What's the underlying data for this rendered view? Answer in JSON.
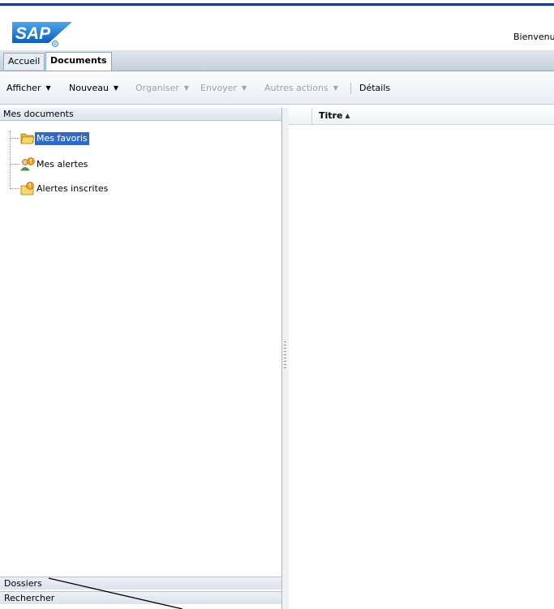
{
  "header": {
    "logo_text": "SAP",
    "welcome_text": "Bienvenu"
  },
  "tabs": [
    {
      "label": "Accueil"
    },
    {
      "label": "Documents",
      "active": true
    }
  ],
  "toolbar": {
    "afficher": "Afficher",
    "nouveau": "Nouveau",
    "organiser": "Organiser",
    "envoyer": "Envoyer",
    "autres_actions": "Autres actions",
    "details": "Détails",
    "dropdown_icon": "triangle-down-icon"
  },
  "left_panel": {
    "title": "Mes documents",
    "tree": [
      {
        "label": "Mes favoris",
        "icon": "folder-open-icon",
        "selected": true
      },
      {
        "label": "Mes alertes",
        "icon": "user-alert-icon"
      },
      {
        "label": "Alertes inscrites",
        "icon": "folder-alert-icon"
      }
    ],
    "accordions": [
      {
        "label": "Dossiers"
      },
      {
        "label": "Rechercher"
      }
    ]
  },
  "grid": {
    "column_title": "Titre",
    "sort_icon": "sort-ascending-icon"
  },
  "colors": {
    "selection": "#316ac5",
    "sap_blue": "#1b70c8",
    "alert_orange": "#f29c1f"
  }
}
